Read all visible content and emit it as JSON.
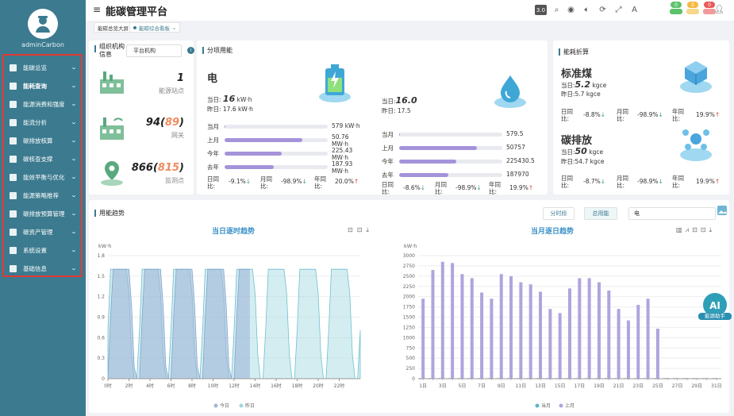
{
  "user": {
    "name": "adminCarbon"
  },
  "sidebar": {
    "items": [
      {
        "label": "能碳总览",
        "icon": "monitor-icon"
      },
      {
        "label": "能耗查询",
        "icon": "bar-chart-icon"
      },
      {
        "label": "能源消费和强度",
        "icon": "consumption-icon"
      },
      {
        "label": "能流分析",
        "icon": "flow-icon"
      },
      {
        "label": "碳排放核算",
        "icon": "calculator-icon"
      },
      {
        "label": "碳核查支撑",
        "icon": "verify-icon"
      },
      {
        "label": "能效平衡与优化",
        "icon": "balance-icon"
      },
      {
        "label": "能源策略推荐",
        "icon": "strategy-icon"
      },
      {
        "label": "碳排放预算管理",
        "icon": "budget-icon"
      },
      {
        "label": "碳资产管理",
        "icon": "asset-icon"
      },
      {
        "label": "系统设置",
        "icon": "wrench-icon"
      },
      {
        "label": "基础信息",
        "icon": "info-icon"
      }
    ]
  },
  "header": {
    "title": "能碳管理平台",
    "version": "3.0",
    "badges": [
      "0",
      "0",
      "0"
    ]
  },
  "tabs": [
    {
      "label": "能碳总览大屏"
    },
    {
      "label": "能碳综合看板"
    }
  ],
  "org": {
    "title": "组织机构信息",
    "select": "平台机构",
    "stats": [
      {
        "value": "1",
        "highlight": "",
        "label": "能源站点"
      },
      {
        "value": "94",
        "highlight": "89",
        "label": "网关"
      },
      {
        "value": "866",
        "highlight": "815",
        "label": "监测点"
      }
    ]
  },
  "sub": {
    "title": "分项用能",
    "elec": {
      "name": "电",
      "today_label": "当日:",
      "today_value": "16",
      "today_unit": "kW·h",
      "yday": "昨日: 17.6 kW·h",
      "rows": [
        {
          "label": "当月",
          "value": "579 kW·h",
          "pct": 0.01
        },
        {
          "label": "上月",
          "value": "50.76 MW·h",
          "pct": 0.75
        },
        {
          "label": "今年",
          "value": "225.43 MW·h",
          "pct": 0.55
        },
        {
          "label": "去年",
          "value": "187.93 MW·h",
          "pct": 0.48
        }
      ],
      "cmp": {
        "d_label": "日同比:",
        "d_value": "-9.1%",
        "m_label": "月同比:",
        "m_value": "-98.9%",
        "y_label": "年同比:",
        "y_value": "20.0%"
      }
    },
    "water": {
      "today_label": "当日:",
      "today_value": "16.0",
      "yday": "昨日: 17.5",
      "rows": [
        {
          "label": "当月",
          "value": "579.5",
          "pct": 0.01
        },
        {
          "label": "上月",
          "value": "50757",
          "pct": 0.75
        },
        {
          "label": "今年",
          "value": "225430.5",
          "pct": 0.55
        },
        {
          "label": "去年",
          "value": "187970",
          "pct": 0.48
        }
      ],
      "cmp": {
        "d_label": "日同比:",
        "d_value": "-8.6%",
        "m_label": "月同比:",
        "m_value": "-98.9%",
        "y_label": "年同比:",
        "y_value": "19.9%"
      }
    }
  },
  "conv": {
    "title": "能耗折算",
    "coal": {
      "name": "标准煤",
      "today_label": "当日:",
      "today_value": "5.2",
      "unit": "kgce",
      "yday": "昨日:5.7 kgce",
      "d_label": "日同比:",
      "d": "-8.8%",
      "m_label": "月同比:",
      "m": "-98.9%",
      "y_label": "年同比:",
      "y": "19.9%"
    },
    "carbon": {
      "name": "碳排放",
      "today_label": "当日:",
      "today_value": "50",
      "unit": "kgce",
      "yday": "昨日:54.7 kgce",
      "d_label": "日同比:",
      "d": "-8.7%",
      "m_label": "月同比:",
      "m": "-98.9%",
      "y_label": "年同比:",
      "y": "19.9%"
    }
  },
  "trend": {
    "title": "用能趋势",
    "btn_period": "分时段",
    "btn_total": "总用能",
    "energy": "电",
    "ai_label": "能源助手"
  },
  "chart_data": [
    {
      "type": "area",
      "title": "当日逐时趋势",
      "ylabel": "kW·h",
      "ylim": [
        0,
        1.8
      ],
      "yticks": [
        "0",
        "0.3",
        "0.6",
        "0.9",
        "1.2",
        "1.5",
        "1.8"
      ],
      "categories": [
        "0时",
        "2时",
        "4时",
        "6时",
        "8时",
        "10时",
        "12时",
        "14时",
        "16时",
        "18时",
        "20时",
        "22时"
      ],
      "series": [
        {
          "name": "今日",
          "color": "#9fb6d8"
        },
        {
          "name": "昨日",
          "color": "#9fd8e0"
        }
      ],
      "shape": {
        "cycle_hours": 3,
        "peak": 1.6,
        "low": 0
      }
    },
    {
      "type": "bar",
      "title": "当月逐日趋势",
      "ylabel": "kW·h",
      "ylim": [
        0,
        3000
      ],
      "yticks": [
        "0",
        "250",
        "500",
        "750",
        "1000",
        "1250",
        "1500",
        "1750",
        "2000",
        "2250",
        "2500",
        "2750",
        "3000"
      ],
      "categories": [
        "1日",
        "2日",
        "3日",
        "4日",
        "5日",
        "6日",
        "7日",
        "8日",
        "9日",
        "10日",
        "11日",
        "12日",
        "13日",
        "14日",
        "15日",
        "16日",
        "17日",
        "18日",
        "19日",
        "20日",
        "21日",
        "22日",
        "23日",
        "24日",
        "25日",
        "26日",
        "27日",
        "28日",
        "29日",
        "30日",
        "31日"
      ],
      "xticks": [
        "1日",
        "3日",
        "5日",
        "7日",
        "9日",
        "11日",
        "13日",
        "15日",
        "17日",
        "19日",
        "21日",
        "23日",
        "25日",
        "27日",
        "29日",
        "31日"
      ],
      "series": [
        {
          "name": "当月",
          "color": "#5cb8c8",
          "values": [
            0,
            0,
            0,
            0,
            0,
            0,
            0,
            0,
            0,
            0,
            0,
            0,
            0,
            0,
            0,
            0,
            0,
            0,
            0,
            0,
            0,
            0,
            0,
            0,
            0,
            0,
            0,
            0,
            0,
            0,
            0
          ]
        },
        {
          "name": "上月",
          "color": "#b0a4de",
          "values": [
            1950,
            2650,
            2850,
            2820,
            2550,
            2450,
            2100,
            1950,
            2550,
            2500,
            2350,
            2300,
            2120,
            1700,
            1600,
            2200,
            2450,
            2450,
            2350,
            2150,
            1700,
            1420,
            1800,
            1950,
            1220,
            0,
            0,
            0,
            0,
            0,
            0
          ]
        }
      ]
    }
  ]
}
